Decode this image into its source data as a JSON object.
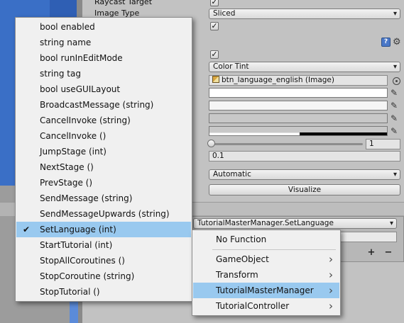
{
  "inspector": {
    "raycast_label": "Raycast Target",
    "image_type_label": "Image Type",
    "image_type_value": "Sliced",
    "transition_value": "Color Tint",
    "target_graphic_value": "btn_language_english (Image)",
    "fade_value": "1",
    "duration_value": "0.1",
    "navigation_value": "Automatic",
    "visualize_label": "Visualize",
    "onclick_function_value": "TutorialMasterManager.SetLanguage",
    "add_label": "+",
    "remove_label": "−"
  },
  "colors": {
    "accent_selected": "#99c9ef",
    "scene_blue": "#3a6fc6",
    "inspector_bg": "#c2c2c2"
  },
  "icons": {
    "check": "checkmark-icon",
    "gear": "gear-icon",
    "help": "help-icon",
    "picker": "eyedropper-icon",
    "submenu": "chevron-right-icon",
    "dropdown": "dropdown-arrow-icon"
  },
  "method_menu": {
    "selected": "SetLanguage (int)",
    "items": [
      "bool enabled",
      "string name",
      "bool runInEditMode",
      "string tag",
      "bool useGUILayout",
      "BroadcastMessage (string)",
      "CancelInvoke (string)",
      "CancelInvoke ()",
      "JumpStage (int)",
      "NextStage ()",
      "PrevStage ()",
      "SendMessage (string)",
      "SendMessageUpwards (string)",
      "SetLanguage (int)",
      "StartTutorial (int)",
      "StopAllCoroutines ()",
      "StopCoroutine (string)",
      "StopTutorial ()"
    ]
  },
  "component_menu": {
    "items": [
      "No Function",
      "GameObject",
      "Transform",
      "TutorialMasterManager",
      "TutorialController"
    ],
    "highlighted": "TutorialMasterManager"
  }
}
